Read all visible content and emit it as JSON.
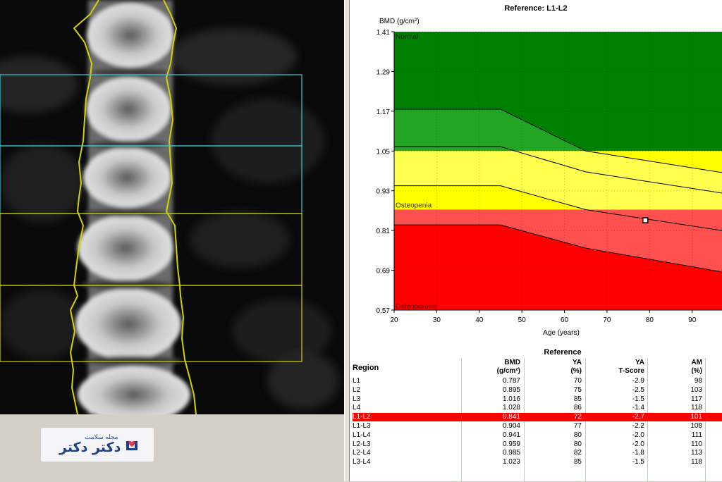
{
  "chart": {
    "title": "Reference: L1-L2",
    "ylabel": "BMD (g/cm²)",
    "xlabel": "Age (years)",
    "zone_labels": {
      "normal": "Normal",
      "osteopenia": "Osteopenia",
      "osteoporosis": "Osteoporosis"
    },
    "colors": {
      "normal": "#008000",
      "osteopenia": "#ffff00",
      "osteoporosis": "#ff0000",
      "normal_light": "#22a522",
      "osteopenia_light": "#ffff4d",
      "osteoporosis_light": "#ff5050"
    }
  },
  "chart_data": {
    "type": "line",
    "title": "Reference: L1-L2",
    "xlabel": "Age (years)",
    "ylabel": "BMD (g/cm²)",
    "xlim": [
      20,
      97
    ],
    "ylim": [
      0.57,
      1.41
    ],
    "x_ticks": [
      20,
      30,
      40,
      50,
      60,
      70,
      80,
      90
    ],
    "y_ticks": [
      0.57,
      0.69,
      0.81,
      0.93,
      1.05,
      1.17,
      1.29,
      1.41
    ],
    "y_tick_labels": [
      "0.57",
      "0.69",
      "0.81",
      "0.93",
      "1.05",
      "1.17",
      "1.29",
      "1.41"
    ],
    "thresholds": {
      "normal_min": 1.05,
      "osteopenia_min": 0.873
    },
    "series": [
      {
        "x": [
          20,
          45,
          65,
          97
        ],
        "y": [
          1.176,
          1.176,
          1.05,
          0.985
        ]
      },
      {
        "x": [
          20,
          45,
          65,
          97
        ],
        "y": [
          1.063,
          1.063,
          0.987,
          0.923
        ]
      },
      {
        "x": [
          20,
          45,
          65,
          97
        ],
        "y": [
          0.945,
          0.945,
          0.873,
          0.81
        ]
      },
      {
        "x": [
          20,
          45,
          65,
          97
        ],
        "y": [
          0.827,
          0.827,
          0.757,
          0.685
        ]
      }
    ],
    "patient_point": {
      "x": 79,
      "y": 0.841
    },
    "grid": true
  },
  "table": {
    "header_reference": "Reference",
    "header_region": "Region",
    "columns": [
      {
        "l1": "BMD",
        "l2": "(g/cm²)"
      },
      {
        "l1": "YA",
        "l2": "(%)"
      },
      {
        "l1": "YA",
        "l2": "T-Score"
      },
      {
        "l1": "AM",
        "l2": "(%)"
      }
    ],
    "rows": [
      {
        "region": "L1",
        "bmd": "0.787",
        "ya": "70",
        "t": "-2.9",
        "am": "98",
        "selected": false
      },
      {
        "region": "L2",
        "bmd": "0.895",
        "ya": "75",
        "t": "-2.5",
        "am": "103",
        "selected": false
      },
      {
        "region": "L3",
        "bmd": "1.016",
        "ya": "85",
        "t": "-1.5",
        "am": "117",
        "selected": false
      },
      {
        "region": "L4",
        "bmd": "1.028",
        "ya": "86",
        "t": "-1.4",
        "am": "118",
        "selected": false
      },
      {
        "region": "L1-L2",
        "bmd": "0.841",
        "ya": "72",
        "t": "-2.7",
        "am": "101",
        "selected": true
      },
      {
        "region": "L1-L3",
        "bmd": "0.904",
        "ya": "77",
        "t": "-2.2",
        "am": "108",
        "selected": false
      },
      {
        "region": "L1-L4",
        "bmd": "0.941",
        "ya": "80",
        "t": "-2.0",
        "am": "111",
        "selected": false
      },
      {
        "region": "L2-L3",
        "bmd": "0.959",
        "ya": "80",
        "t": "-2.0",
        "am": "110",
        "selected": false
      },
      {
        "region": "L2-L4",
        "bmd": "0.985",
        "ya": "82",
        "t": "-1.8",
        "am": "113",
        "selected": false
      },
      {
        "region": "L3-L4",
        "bmd": "1.023",
        "ya": "85",
        "t": "-1.5",
        "am": "118",
        "selected": false
      }
    ]
  },
  "logo": {
    "small_text": "مجله سلامت",
    "main_text": "دکتر دکتر",
    "color": "#1e3f8a",
    "accent": "#e8384f"
  },
  "scan": {
    "roi_colors": {
      "cyan": "#3cc8d2",
      "yellow": "#d2d200"
    }
  }
}
